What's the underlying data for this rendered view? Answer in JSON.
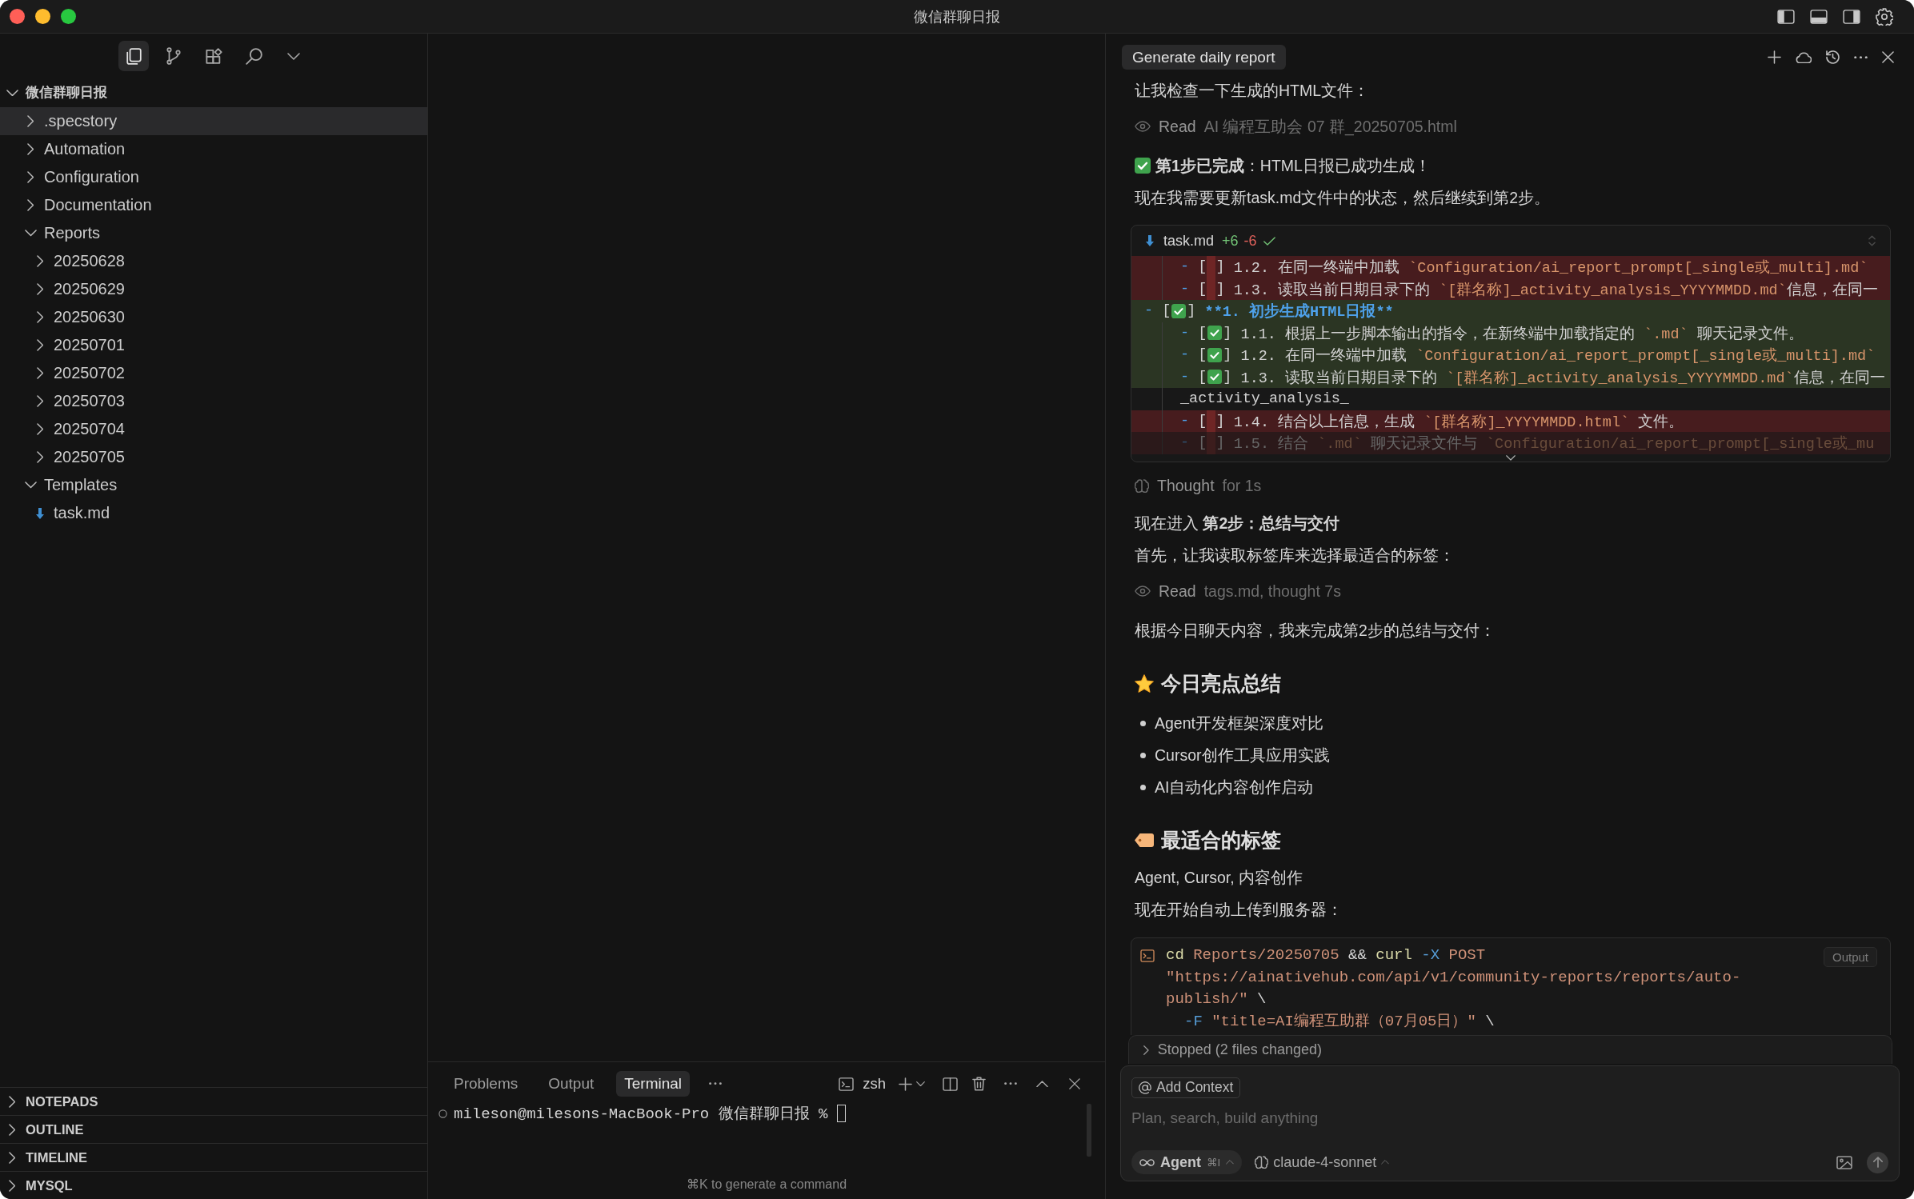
{
  "window": {
    "title": "微信群聊日报"
  },
  "sidebar": {
    "views": [
      {
        "selected": true
      },
      {
        "selected": false
      },
      {
        "selected": false
      },
      {
        "selected": false
      }
    ],
    "tree": {
      "label": "微信群聊日报",
      "expanded": true,
      "children": [
        {
          "label": ".specstory",
          "kind": "folder",
          "expanded": false,
          "selected": true
        },
        {
          "label": "Automation",
          "kind": "folder",
          "expanded": false,
          "selected": false
        },
        {
          "label": "Configuration",
          "kind": "folder",
          "expanded": false,
          "selected": false
        },
        {
          "label": "Documentation",
          "kind": "folder",
          "expanded": false,
          "selected": false
        },
        {
          "label": "Reports",
          "kind": "folder",
          "expanded": true,
          "selected": false,
          "children": [
            {
              "label": "20250628",
              "kind": "folder",
              "expanded": false,
              "selected": false
            },
            {
              "label": "20250629",
              "kind": "folder",
              "expanded": false,
              "selected": false
            },
            {
              "label": "20250630",
              "kind": "folder",
              "expanded": false,
              "selected": false
            },
            {
              "label": "20250701",
              "kind": "folder",
              "expanded": false,
              "selected": false
            },
            {
              "label": "20250702",
              "kind": "folder",
              "expanded": false,
              "selected": false
            },
            {
              "label": "20250703",
              "kind": "folder",
              "expanded": false,
              "selected": false
            },
            {
              "label": "20250704",
              "kind": "folder",
              "expanded": false,
              "selected": false
            },
            {
              "label": "20250705",
              "kind": "folder",
              "expanded": false,
              "selected": false
            }
          ]
        },
        {
          "label": "Templates",
          "kind": "folder",
          "expanded": true,
          "selected": false,
          "children": [
            {
              "label": "task.md",
              "kind": "file",
              "selected": false
            }
          ]
        }
      ]
    },
    "sections": [
      {
        "label": "NOTEPADS",
        "expanded": false
      },
      {
        "label": "OUTLINE",
        "expanded": false
      },
      {
        "label": "TIMELINE",
        "expanded": false
      },
      {
        "label": "MYSQL",
        "expanded": false
      }
    ]
  },
  "panel": {
    "tabs": [
      {
        "label": "Problems",
        "selected": false
      },
      {
        "label": "Output",
        "selected": false
      },
      {
        "label": "Terminal",
        "selected": true
      }
    ],
    "shell": "zsh",
    "terminal": {
      "prompt": "mileson@milesons-MacBook-Pro 微信群聊日报 %"
    },
    "hint": "⌘K to generate a command"
  },
  "chat": {
    "tabs": [
      {
        "label": "Generate daily report",
        "selected": true
      }
    ],
    "messages": [
      {
        "kind": "text",
        "text": "让我检查一下生成的HTML文件："
      },
      {
        "kind": "tool",
        "action": "Read",
        "detail": "AI 编程互助会 07 群_20250705.html"
      },
      {
        "kind": "success",
        "text": "**第1步已完成**：HTML日报已成功生成！"
      },
      {
        "kind": "text",
        "text": "现在我需要更新task.md文件中的状态，然后继续到第2步。"
      },
      {
        "kind": "diff",
        "file": "task.md",
        "added": "+6",
        "removed": "-6",
        "applied": true,
        "lines": [
          {
            "deleted": true,
            "inserted": false,
            "kind": "subitem",
            "prefix": "- [",
            "checked": false,
            "close": "]",
            "text": "1.2. 在同一终端中加载 `Configuration/ai_report_prompt[_single或_multi].md`"
          },
          {
            "deleted": true,
            "inserted": false,
            "kind": "subitem",
            "prefix": "- [",
            "checked": false,
            "close": "]",
            "text": "1.3. 读取当前日期目录下的 `[群名称]_activity_analysis_YYYYMMDD.md`信息，在同一"
          },
          {
            "deleted": false,
            "inserted": true,
            "kind": "item",
            "prefix": "- [",
            "checked": true,
            "close": "]",
            "text": "**1. 初步生成HTML日报**"
          },
          {
            "deleted": false,
            "inserted": true,
            "kind": "subitem",
            "prefix": "- [",
            "checked": true,
            "close": "]",
            "text": "1.1. 根据上一步脚本输出的指令，在新终端中加载指定的 `.md` 聊天记录文件。"
          },
          {
            "deleted": false,
            "inserted": true,
            "kind": "subitem",
            "prefix": "- [",
            "checked": true,
            "close": "]",
            "text": "1.2. 在同一终端中加载 `Configuration/ai_report_prompt[_single或_multi].md`"
          },
          {
            "deleted": false,
            "inserted": true,
            "kind": "subitem",
            "prefix": "- [",
            "checked": true,
            "close": "]",
            "text": "1.3. 读取当前日期目录下的 `[群名称]_activity_analysis_YYYYMMDD.md`信息，在同一"
          },
          {
            "deleted": false,
            "inserted": false,
            "kind": "wrap",
            "text": "_activity_analysis_"
          },
          {
            "deleted": true,
            "inserted": false,
            "kind": "subitem",
            "prefix": "- [",
            "checked": false,
            "close": "]",
            "text": "1.4. 结合以上信息，生成 `[群名称]_YYYYMMDD.html` 文件。"
          },
          {
            "deleted": true,
            "inserted": false,
            "kind": "subitem",
            "prefix": "- [",
            "checked": false,
            "close": "]",
            "text": "1.5. 结合 `.md` 聊天记录文件与 `Configuration/ai_report_prompt[_single或_mu"
          }
        ]
      },
      {
        "kind": "thought",
        "label": "Thought",
        "detail": "for 1s"
      },
      {
        "kind": "text",
        "text": "现在进入 **第2步：总结与交付**"
      },
      {
        "kind": "text",
        "text": "首先，让我读取标签库来选择最适合的标签："
      },
      {
        "kind": "tool",
        "action": "Read",
        "detail": "tags.md, thought 7s"
      },
      {
        "kind": "text",
        "text": "根据今日聊天内容，我来完成第2步的总结与交付："
      },
      {
        "kind": "heading",
        "text": "今日亮点总结"
      },
      {
        "kind": "list",
        "items": [
          "Agent开发框架深度对比",
          "Cursor创作工具应用实践",
          "AI自动化内容创作启动"
        ]
      },
      {
        "kind": "heading",
        "text": "最适合的标签"
      },
      {
        "kind": "text",
        "text": "Agent, Cursor, 内容创作"
      },
      {
        "kind": "text",
        "text": "现在开始自动上传到服务器："
      },
      {
        "kind": "command",
        "output_button": "Output",
        "lines": [
          {
            "kind": "main",
            "tokens": [
              {
                "kind": "command",
                "text": "cd"
              },
              {
                "kind": "argument",
                "text": "Reports/20250705"
              },
              {
                "kind": "operator",
                "text": "&&"
              },
              {
                "kind": "command",
                "text": "curl"
              },
              {
                "kind": "flag",
                "text": "-X"
              },
              {
                "kind": "argument",
                "text": "POST"
              }
            ]
          },
          {
            "kind": "main",
            "tokens": [
              {
                "kind": "string",
                "text": "\"https://ainativehub.com/api/v1/community-reports/reports/auto-"
              }
            ]
          },
          {
            "kind": "main",
            "tokens": [
              {
                "kind": "string",
                "text": "publish/\""
              },
              {
                "kind": "operator",
                "text": "\\"
              }
            ]
          },
          {
            "kind": "nested",
            "tokens": [
              {
                "kind": "flag",
                "text": "-F"
              },
              {
                "kind": "string",
                "text": "\"title=AI编程互助群（07月05日）\""
              },
              {
                "kind": "operator",
                "text": "\\"
              }
            ]
          }
        ]
      }
    ],
    "status": "Stopped (2 files changed)",
    "composer": {
      "context_button": "Add Context",
      "placeholder": "Plan, search, build anything",
      "mode": {
        "label": "Agent",
        "shortcut": "⌘I"
      },
      "model": "claude-4-sonnet"
    }
  }
}
